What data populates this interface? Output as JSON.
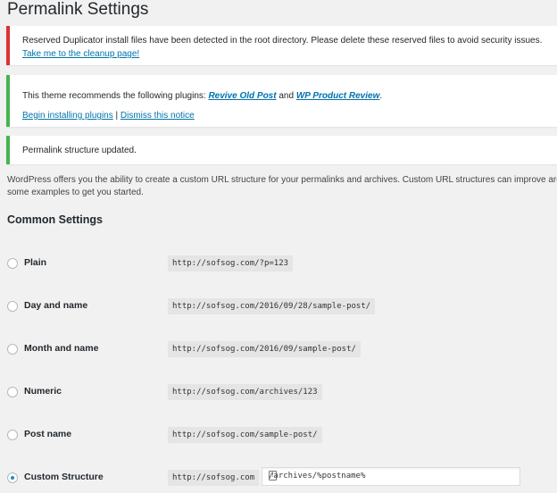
{
  "page": {
    "title": "Permalink Settings"
  },
  "notices": {
    "duplicator": {
      "text": "Reserved Duplicator install files have been detected in the root directory. Please delete these reserved files to avoid security issues.",
      "link": "Take me to the cleanup page!"
    },
    "theme": {
      "text_before": "This theme recommends the following plugins: ",
      "plugin1": "Revive Old Post",
      "and": " and ",
      "plugin2": "WP Product Review",
      "period": ".",
      "install_link": "Begin installing plugins",
      "separator": " | ",
      "dismiss_link": "Dismiss this notice"
    },
    "updated": {
      "text": "Permalink structure updated."
    }
  },
  "intro": "WordPress offers you the ability to create a custom URL structure for your permalinks and archives. Custom URL structures can improve are some examples to get you started.",
  "common_settings": {
    "title": "Common Settings",
    "options": [
      {
        "label": "Plain",
        "example": "http://sofsog.com/?p=123",
        "checked": false
      },
      {
        "label": "Day and name",
        "example": "http://sofsog.com/2016/09/28/sample-post/",
        "checked": false
      },
      {
        "label": "Month and name",
        "example": "http://sofsog.com/2016/09/sample-post/",
        "checked": false
      },
      {
        "label": "Numeric",
        "example": "http://sofsog.com/archives/123",
        "checked": false
      },
      {
        "label": "Post name",
        "example": "http://sofsog.com/sample-post/",
        "checked": false
      },
      {
        "label": "Custom Structure",
        "example": "http://sofsog.com",
        "checked": true
      }
    ],
    "custom_value": "/archives/%postname%",
    "custom_icon": "info-box-icon"
  },
  "colors": {
    "error": "#dc3232",
    "success": "#46b450",
    "link": "#0073aa",
    "radio_checked": "#1e8cbe"
  }
}
